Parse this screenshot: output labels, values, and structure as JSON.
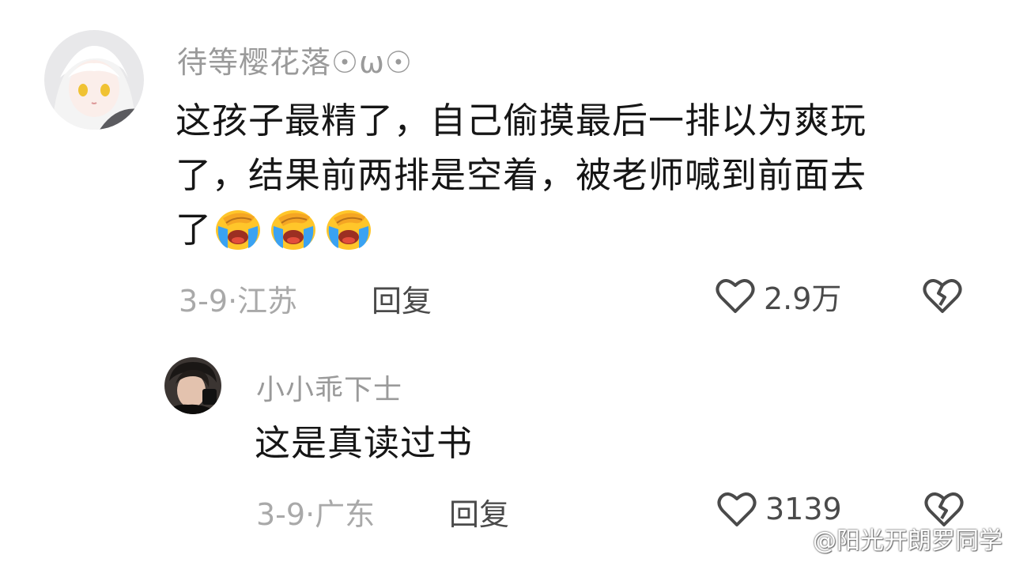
{
  "comments": [
    {
      "username": "待等樱花落☉ω☉",
      "text_lines": [
        "这孩子最精了，自己偷摸最后一排以为爽玩",
        "了，结果前两排是空着，被老师喊到前面去",
        "了"
      ],
      "emoji": "crying-laughing-emoji",
      "emoji_count": 3,
      "date": "3-9·江苏",
      "reply_label": "回复",
      "like_count": "2.9万"
    },
    {
      "username": "小小乖下士",
      "text": "这是真读过书",
      "date": "3-9·广东",
      "reply_label": "回复",
      "like_count": "3139"
    }
  ],
  "icons": {
    "like": "heart-outline-icon",
    "dislike": "broken-heart-icon"
  },
  "watermark": "@阳光开朗罗同学",
  "colors": {
    "username": "#9a9a9a",
    "body_text": "#161616",
    "meta_text": "#a9a9a9",
    "action_text": "#4a4a4a",
    "emoji_face": "#ffc62a",
    "emoji_tears": "#3aa2f2"
  }
}
